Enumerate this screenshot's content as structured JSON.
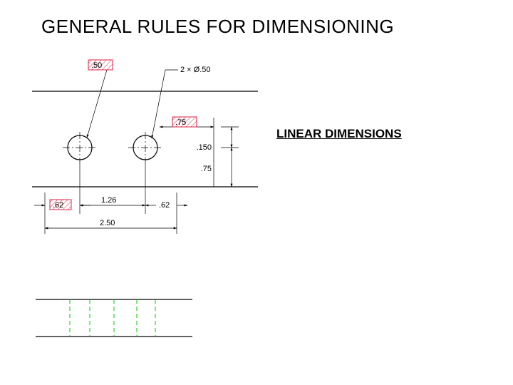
{
  "title": "GENERAL RULES FOR DIMENSIONING",
  "subtitle": "LINEAR DIMENSIONS",
  "diagram": {
    "leader1": ".50",
    "leader2": "2 × Ø.50",
    "dim_h_upper_right": ".75",
    "dim_v_small": ".150",
    "dim_v_large": ".75",
    "dim_h_left": ".62",
    "dim_h_mid": "1.26",
    "dim_h_right": ".62",
    "dim_overall": "2.50"
  }
}
